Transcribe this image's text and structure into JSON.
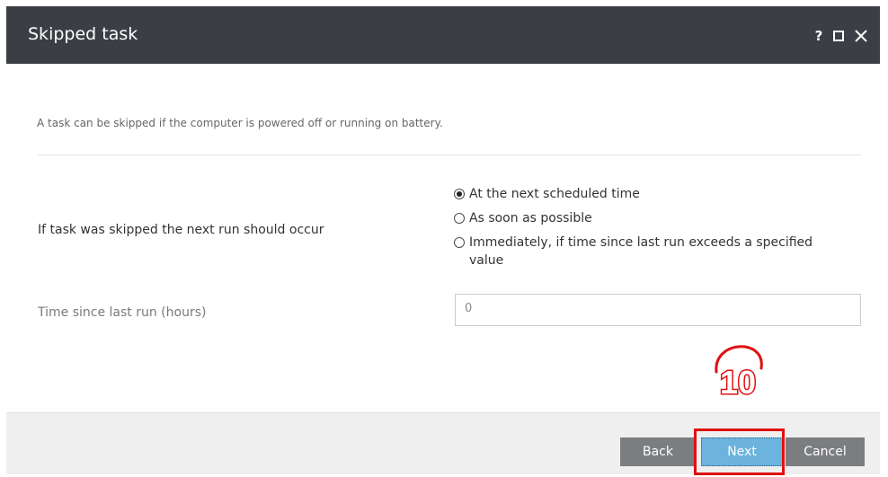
{
  "dialog": {
    "title": "Skipped task",
    "help_icon": "?",
    "icons": [
      "help-icon",
      "maximize-icon",
      "close-icon"
    ]
  },
  "description": "A task can be skipped if the computer is powered off or running on battery.",
  "skip_field": {
    "label": "If task was skipped the next run should occur",
    "options": [
      {
        "label": "At the next scheduled time",
        "selected": true
      },
      {
        "label": "As soon as possible",
        "selected": false
      },
      {
        "label": "Immediately, if time since last run exceeds a specified value",
        "selected": false
      }
    ]
  },
  "hours_field": {
    "label": "Time since last run (hours)",
    "value": "0"
  },
  "annotation": {
    "step_number": "10",
    "color": "#e01010"
  },
  "footer": {
    "back_label": "Back",
    "next_label": "Next",
    "cancel_label": "Cancel"
  }
}
